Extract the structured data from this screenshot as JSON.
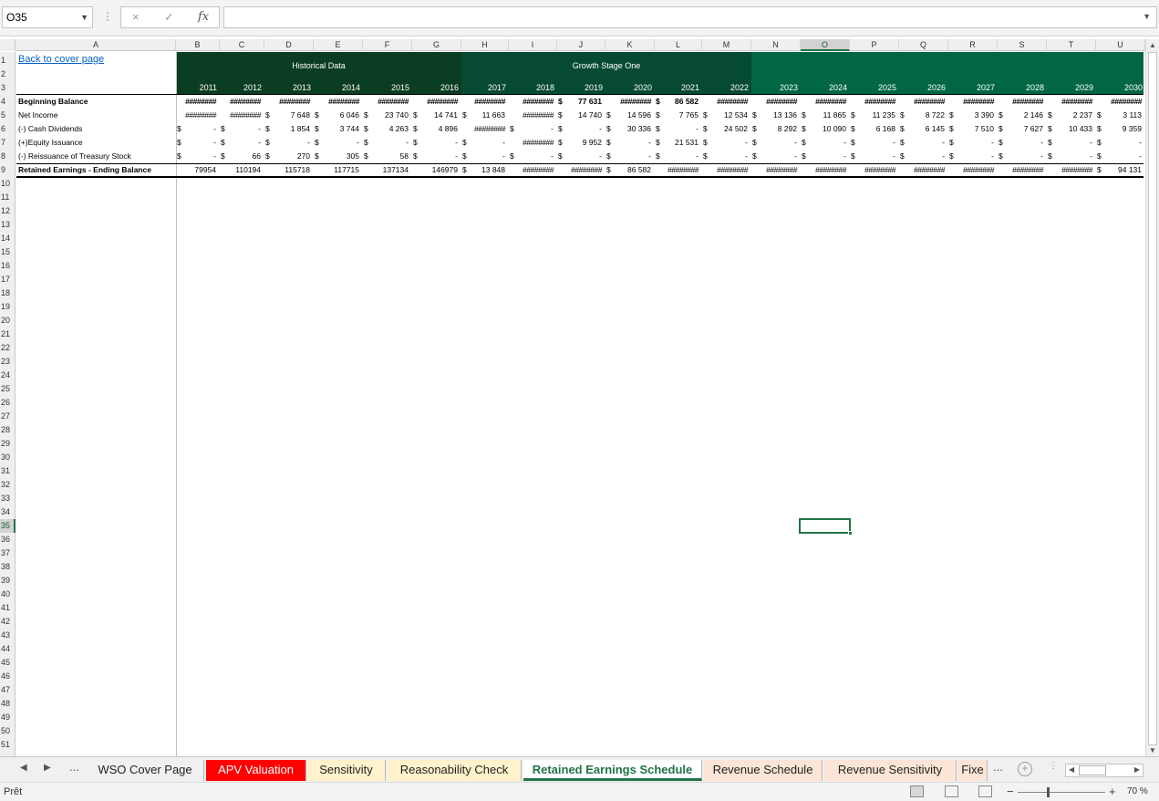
{
  "formula_bar": {
    "name_box": "O35",
    "cancel_icon": "×",
    "enter_icon": "✓",
    "fx_icon": "fx",
    "formula": ""
  },
  "columns": [
    "A",
    "B",
    "C",
    "D",
    "E",
    "F",
    "G",
    "H",
    "I",
    "J",
    "K",
    "L",
    "M",
    "N",
    "O",
    "P",
    "Q",
    "R",
    "S",
    "T",
    "U"
  ],
  "selected_column": "O",
  "selected_row": 35,
  "rows_count": 51,
  "sheet": {
    "link_text": "Back to cover page",
    "bands": [
      {
        "label": "Historical Data",
        "color": "#0b3d22"
      },
      {
        "label": "Growth Stage One",
        "color": "#064a32"
      },
      {
        "label": "",
        "color": "#006644"
      }
    ],
    "years": [
      "2011",
      "2012",
      "2013",
      "2014",
      "2015",
      "2016",
      "2017",
      "2018",
      "2019",
      "2020",
      "2021",
      "2022",
      "2023",
      "2024",
      "2025",
      "2026",
      "2027",
      "2028",
      "2029",
      "2030"
    ],
    "row_labels": [
      "Beginning Balance",
      "Net Income",
      "(-) Cash Dividends",
      "(+)Equity Issuance",
      "(-) Reissuance of Treasury Stock",
      "Retained Earnings - Ending Balance"
    ],
    "data": [
      [
        "########",
        "########",
        "########",
        "########",
        "########",
        "########",
        "########",
        "########",
        "$ 77 631",
        "########",
        "$ 86 582",
        "########",
        "########",
        "########",
        "########",
        "########",
        "########",
        "########",
        "########",
        "########"
      ],
      [
        "########",
        "########",
        "$   7 648",
        "$   6 046",
        "$ 23 740",
        "$ 14 741",
        "$ 11 663",
        "########",
        "$ 14 740",
        "$ 14 596",
        "$   7 765",
        "$ 12 534",
        "$ 13 136",
        "$ 11 865",
        "$ 11 235",
        "$   8 722",
        "$   3 390",
        "$   2 146",
        "$   2 237",
        "$   3 113"
      ],
      [
        "$   -",
        "$   -",
        "$   1 854",
        "$   3 744",
        "$   4 263",
        "$   4 896",
        "########",
        "$   -",
        "$   -",
        "$ 30 336",
        "$   -",
        "$ 24 502",
        "$   8 292",
        "$ 10 090",
        "$   6 168",
        "$   6 145",
        "$   7 510",
        "$   7 627",
        "$ 10 433",
        "$   9 359"
      ],
      [
        "$   -",
        "$   -",
        "$   -",
        "$   -",
        "$   -",
        "$   -",
        "$   -",
        "########",
        "$   9 952",
        "$   -",
        "$ 21 531",
        "$   -",
        "$   -",
        "$   -",
        "$   -",
        "$   -",
        "$   -",
        "$   -",
        "$   -",
        "$   -"
      ],
      [
        "$   -",
        "$   66",
        "$   270",
        "$   305",
        "$   58",
        "$   -",
        "$   -",
        "$   -",
        "$   -",
        "$   -",
        "$   -",
        "$   -",
        "$   -",
        "$   -",
        "$   -",
        "$   -",
        "$   -",
        "$   -",
        "$   -",
        "$   -"
      ],
      [
        "79954",
        "110194",
        "115718",
        "117715",
        "137134",
        "146979",
        "$ 13 848",
        "########",
        "########",
        "$ 86 582",
        "########",
        "########",
        "########",
        "########",
        "########",
        "########",
        "########",
        "########",
        "########",
        "$ 94 131"
      ]
    ]
  },
  "tabs": [
    {
      "label": "WSO Cover Page",
      "bg": "#f0f0f0",
      "color": "#222"
    },
    {
      "label": "APV Valuation",
      "bg": "#ff0000",
      "color": "#ffffff"
    },
    {
      "label": "Sensitivity",
      "bg": "#fff2cc",
      "color": "#222"
    },
    {
      "label": "Reasonability Check",
      "bg": "#fff2cc",
      "color": "#222"
    },
    {
      "label": "Retained Earnings Schedule",
      "bg": "#ffffff",
      "color": "#217346"
    },
    {
      "label": "Revenue Schedule",
      "bg": "#fce4d6",
      "color": "#222"
    },
    {
      "label": "Revenue Sensitivity",
      "bg": "#fce4d6",
      "color": "#222"
    },
    {
      "label": "Fixe",
      "bg": "#fce4d6",
      "color": "#222"
    }
  ],
  "active_tab": "Retained Earnings Schedule",
  "tab_more": "...",
  "status": {
    "text": "Prêt",
    "zoom": "70 %"
  }
}
